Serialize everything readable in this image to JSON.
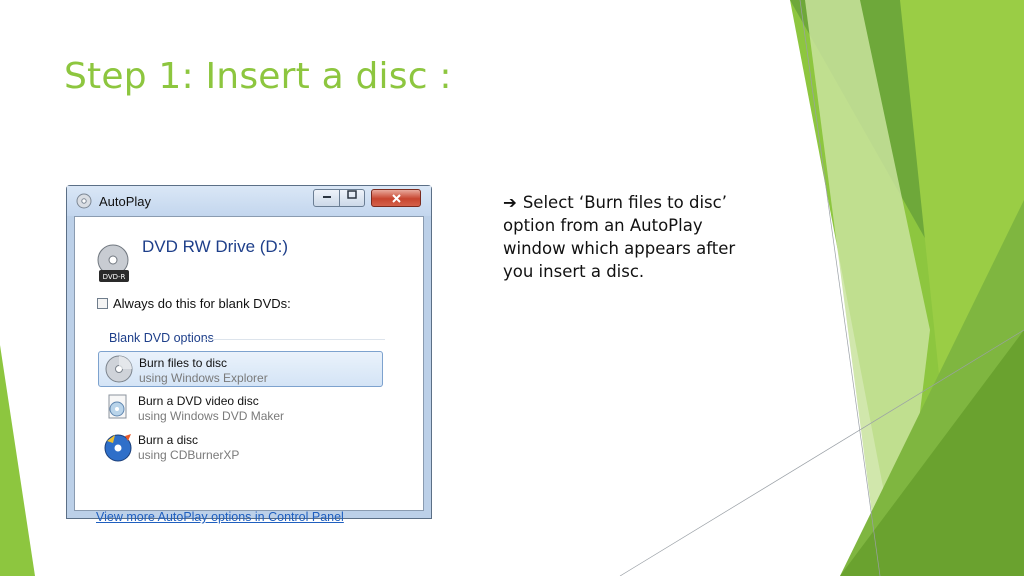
{
  "slide": {
    "title": "Step 1: Insert a disc :",
    "note_arrow": "➔",
    "note_text": "Select ‘Burn files to disc’ option from an AutoPlay window which appears after you insert a disc."
  },
  "colors": {
    "title_green": "#8DC63F",
    "accent_green_light": "#A9D35B",
    "accent_green_dark": "#5E9E2C"
  },
  "window": {
    "title": "AutoPlay",
    "minimize_icon": "minimize-icon",
    "maximize_icon": "maximize-icon",
    "close_icon": "close-icon",
    "drive_name": "DVD RW Drive (D:)",
    "drive_badge": "DVD-R",
    "always_checkbox_label": "Always do this for blank DVDs:",
    "always_checked": false,
    "section_heading": "Blank DVD options",
    "options": [
      {
        "title": "Burn files to disc",
        "subtitle": "using Windows Explorer",
        "icon": "disc-icon",
        "selected": true
      },
      {
        "title": "Burn a DVD video disc",
        "subtitle": "using Windows DVD Maker",
        "icon": "dvd-maker-icon",
        "selected": false
      },
      {
        "title": "Burn a disc",
        "subtitle": "using CDBurnerXP",
        "icon": "cdburnerxp-icon",
        "selected": false
      }
    ],
    "control_panel_link": "View more AutoPlay options in Control Panel"
  }
}
